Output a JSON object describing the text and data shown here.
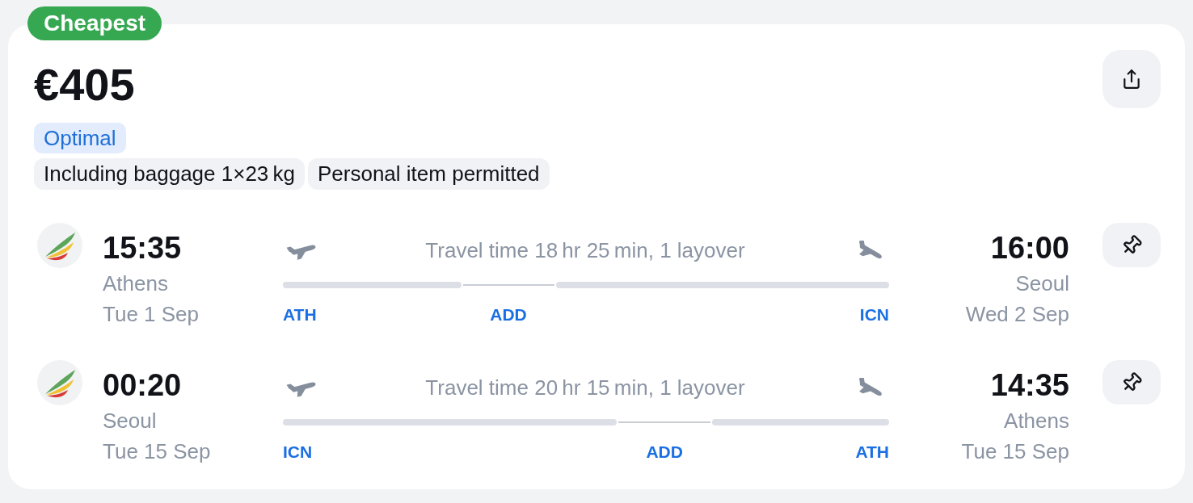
{
  "badge": {
    "label": "Cheapest"
  },
  "price": "€405",
  "rating": "Optimal",
  "features": [
    "Including baggage 1×23 kg",
    "Personal item permitted"
  ],
  "legs": [
    {
      "departure": {
        "time": "15:35",
        "city": "Athens",
        "date": "Tue 1 Sep"
      },
      "travel_info": "Travel time 18 hr 25 min, 1 layover",
      "stops": [
        "ATH",
        "ADD",
        "ICN"
      ],
      "arrival": {
        "time": "16:00",
        "city": "Seoul",
        "date": "Wed 2 Sep"
      }
    },
    {
      "departure": {
        "time": "00:20",
        "city": "Seoul",
        "date": "Tue 15 Sep"
      },
      "travel_info": "Travel time 20 hr 15 min, 1 layover",
      "stops": [
        "ICN",
        "ADD",
        "ATH"
      ],
      "arrival": {
        "time": "14:35",
        "city": "Athens",
        "date": "Tue 15 Sep"
      }
    }
  ]
}
